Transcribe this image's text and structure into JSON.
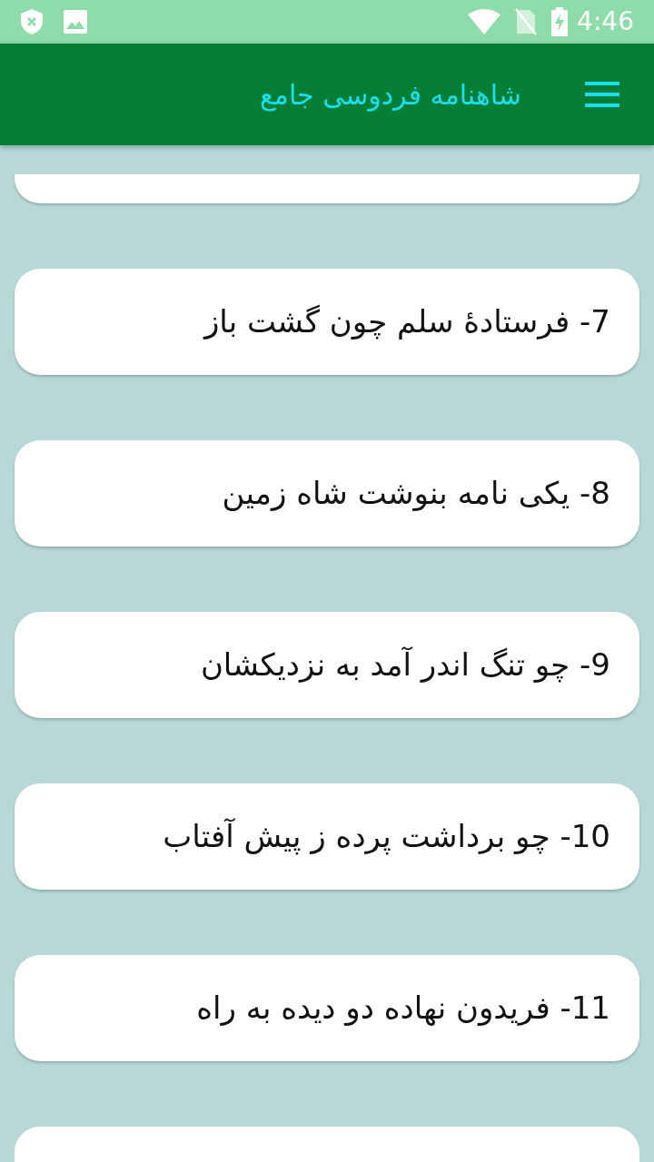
{
  "status_bar": {
    "time": "4:46"
  },
  "app_bar": {
    "title": "شاهنامه فردوسی جامع"
  },
  "list": [
    {
      "kind": "partial_top"
    },
    {
      "kind": "item",
      "label": "7- فرستادهٔ سلم چون گشت باز"
    },
    {
      "kind": "item",
      "label": "8- یکی نامه بنوشت شاه زمین"
    },
    {
      "kind": "item",
      "label": "9- چو تنگ اندر آمد به نزدیکشان"
    },
    {
      "kind": "item",
      "label": "10- چو برداشت پرده ز پیش آفتاب"
    },
    {
      "kind": "item",
      "label": "11- فریدون نهاده دو دیده به راه"
    },
    {
      "kind": "partial_bottom"
    }
  ]
}
